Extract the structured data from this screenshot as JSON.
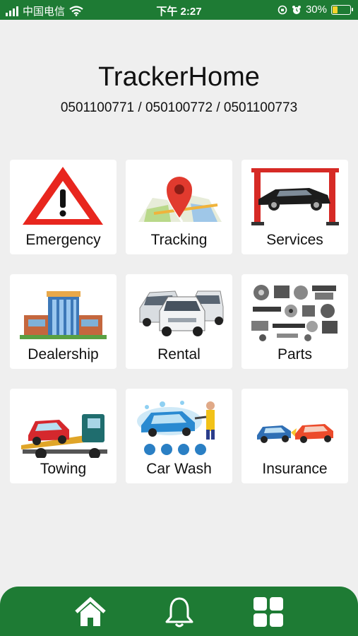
{
  "status_bar": {
    "carrier": "中国电信",
    "time": "下午 2:27",
    "battery": "30%",
    "battery_level": 0.3
  },
  "header": {
    "title": "TrackerHome",
    "phones": "0501100771 / 050100772 / 0501100773"
  },
  "tiles": [
    {
      "label": "Emergency",
      "icon": "warning-triangle-icon"
    },
    {
      "label": "Tracking",
      "icon": "map-pin-icon"
    },
    {
      "label": "Services",
      "icon": "car-lift-icon"
    },
    {
      "label": "Dealership",
      "icon": "dealership-building-icon"
    },
    {
      "label": "Rental",
      "icon": "rental-cars-icon"
    },
    {
      "label": "Parts",
      "icon": "car-parts-icon"
    },
    {
      "label": "Towing",
      "icon": "tow-truck-icon"
    },
    {
      "label": "Car Wash",
      "icon": "car-wash-icon"
    },
    {
      "label": "Insurance",
      "icon": "car-crash-icon"
    }
  ],
  "bottom_nav": [
    {
      "icon": "home-icon"
    },
    {
      "icon": "bell-icon"
    },
    {
      "icon": "grid-icon"
    }
  ],
  "colors": {
    "brand_green": "#1e7b34",
    "background": "#efefef",
    "tile": "#ffffff"
  }
}
